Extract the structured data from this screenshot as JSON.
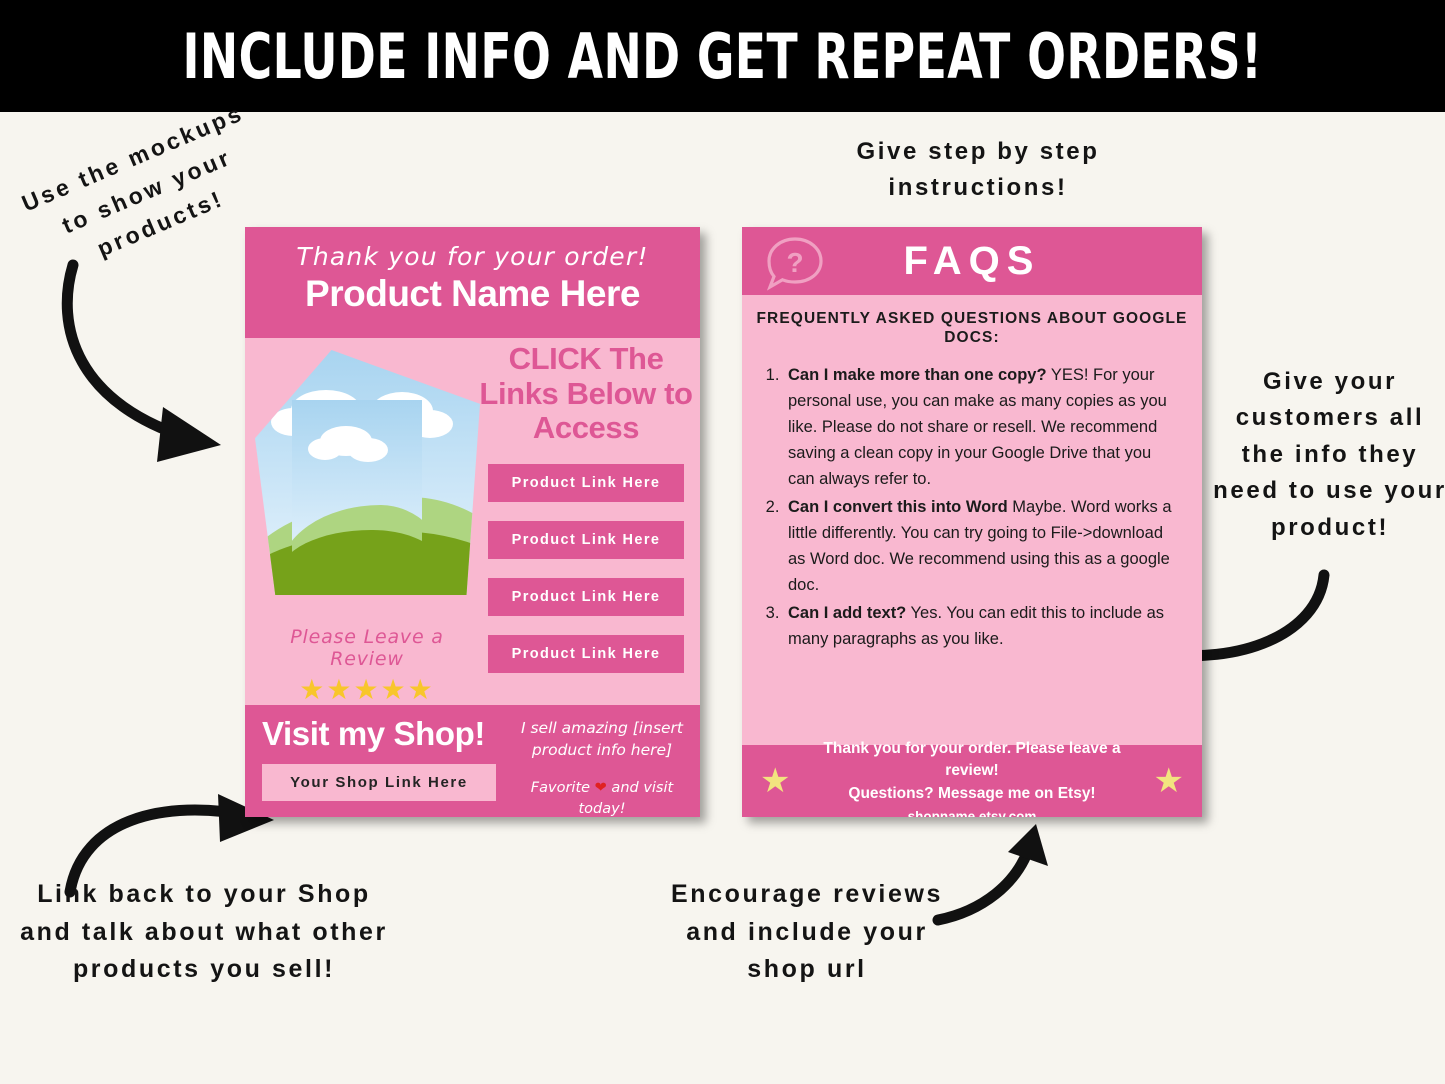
{
  "banner": {
    "title": "INCLUDE INFO AND GET REPEAT ORDERS!"
  },
  "annotations": {
    "top_left": "Use the mockups to show your products!",
    "top_center": "Give step by step instructions!",
    "right": "Give your customers all the info they need to use your product!",
    "bottom_left": "Link back to your Shop and talk about what other products you sell!",
    "bottom_center": "Encourage reviews and include your shop url"
  },
  "left_card": {
    "thank_you": "Thank you for your order!",
    "product_name": "Product Name Here",
    "click_heading": "CLICK The Links Below to Access",
    "links": [
      "Product Link Here",
      "Product Link Here",
      "Product Link Here",
      "Product Link Here"
    ],
    "review_text": "Please Leave a Review",
    "stars": "★★★★★",
    "shop_title": "Visit my Shop!",
    "shop_link": "Your Shop Link Here",
    "sell_line": "I sell amazing [insert product info here]",
    "favorite_pre": "Favorite ",
    "favorite_heart": "❤",
    "favorite_post": " and visit today!"
  },
  "right_card": {
    "title": "FAQS",
    "subtitle": "FREQUENTLY ASKED QUESTIONS ABOUT GOOGLE DOCS:",
    "faqs": [
      {
        "question": "Can I make more than one copy?",
        "answer": "  YES! For your personal use, you can make as many copies as you like.  Please do not share or resell.  We recommend saving a clean copy in your Google Drive that you can always refer to."
      },
      {
        "question": "Can I convert this into Word",
        "answer": "  Maybe. Word works a little differently.  You can try going to File->download as Word doc.  We recommend using this as a google doc."
      },
      {
        "question": "Can I add text?",
        "answer": " Yes. You can edit this to include as many paragraphs as you like."
      }
    ],
    "footer_line1": "Thank you for your order. Please leave a review!",
    "footer_line2": "Questions? Message me on Etsy!",
    "footer_url": "shopname.etsy.com",
    "footer_star": "★"
  },
  "colors": {
    "banner_bg": "#000000",
    "page_bg": "#f7f5ef",
    "pink_dark": "#de5795",
    "pink_light": "#f9b8d0",
    "star_gold": "#f8c62b",
    "footer_star": "#f2e47f",
    "heart_red": "#e02121"
  }
}
